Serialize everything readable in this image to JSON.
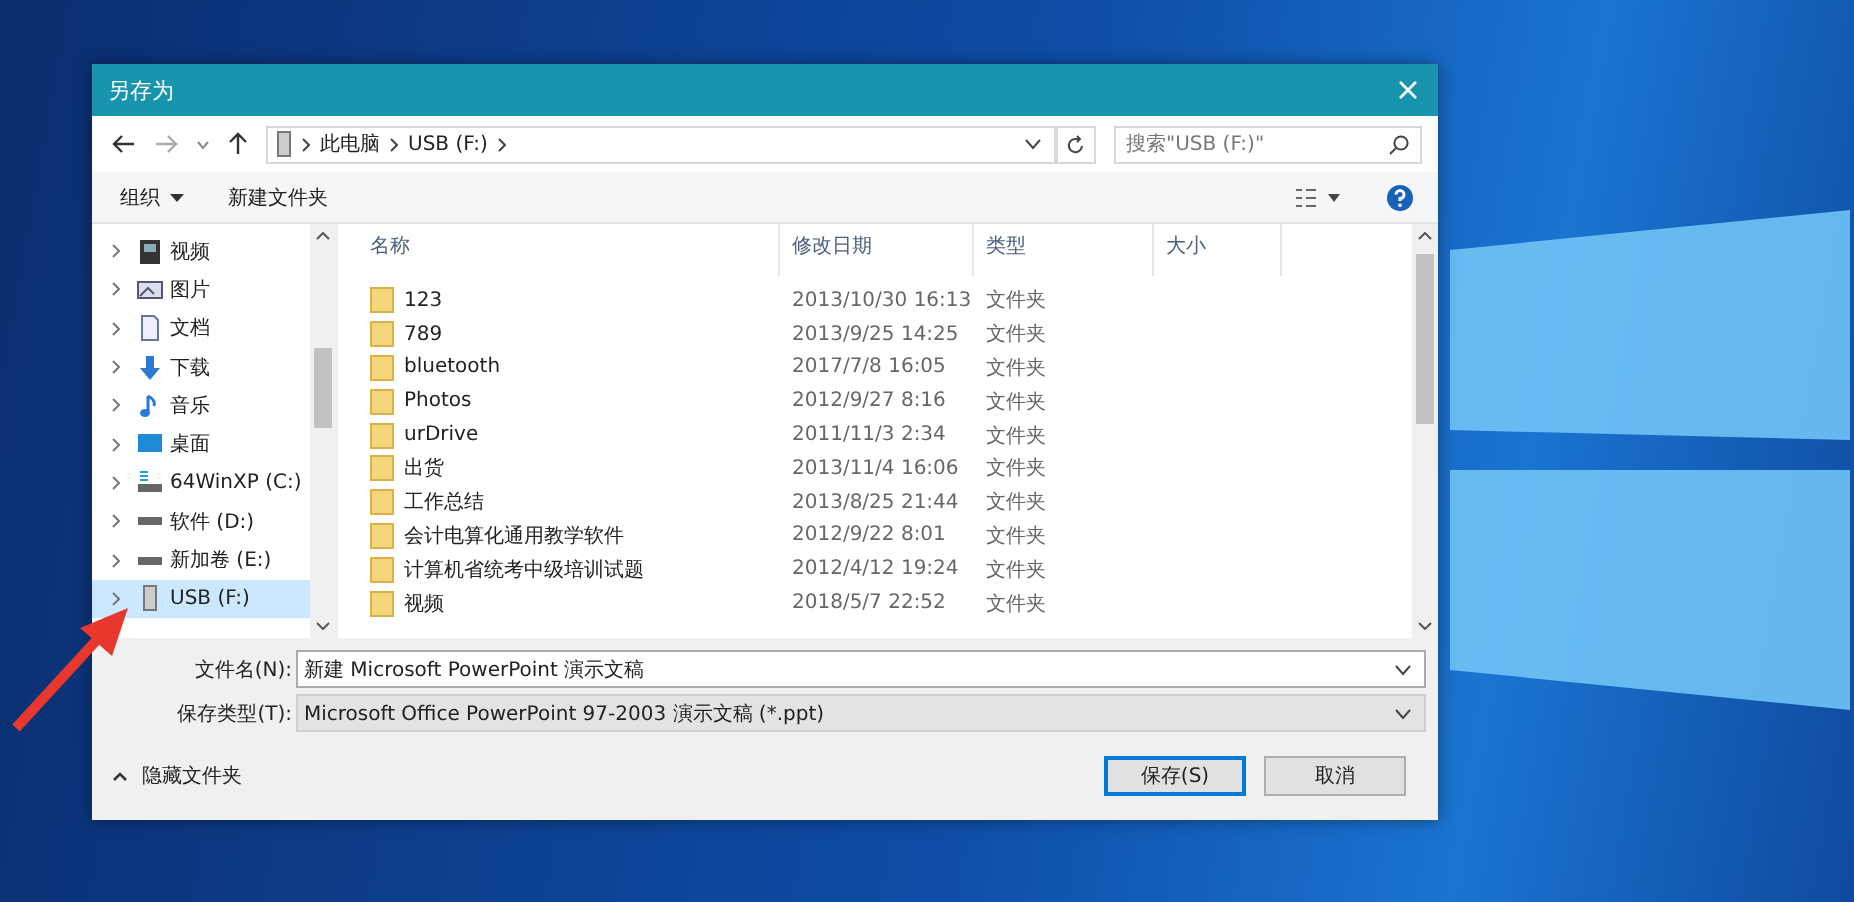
{
  "window": {
    "title": "另存为"
  },
  "address": {
    "crumbs": [
      "此电脑",
      "USB (F:)"
    ],
    "search_placeholder": "搜索\"USB (F:)\""
  },
  "toolbar": {
    "organize": "组织",
    "new_folder": "新建文件夹"
  },
  "sidebar": {
    "items": [
      {
        "label": "视频",
        "kind": "video",
        "selected": false
      },
      {
        "label": "图片",
        "kind": "picture",
        "selected": false
      },
      {
        "label": "文档",
        "kind": "document",
        "selected": false
      },
      {
        "label": "下载",
        "kind": "download",
        "selected": false
      },
      {
        "label": "音乐",
        "kind": "music",
        "selected": false
      },
      {
        "label": "桌面",
        "kind": "desktop",
        "selected": false
      },
      {
        "label": "64WinXP  (C:)",
        "kind": "system-drive",
        "selected": false
      },
      {
        "label": "软件 (D:)",
        "kind": "drive",
        "selected": false
      },
      {
        "label": "新加卷 (E:)",
        "kind": "drive",
        "selected": false
      },
      {
        "label": "USB (F:)",
        "kind": "usb",
        "selected": true
      }
    ]
  },
  "table": {
    "columns": [
      "名称",
      "修改日期",
      "类型",
      "大小"
    ],
    "rows": [
      {
        "name": "123",
        "date": "2013/10/30 16:13",
        "type": "文件夹"
      },
      {
        "name": "789",
        "date": "2013/9/25 14:25",
        "type": "文件夹"
      },
      {
        "name": "bluetooth",
        "date": "2017/7/8 16:05",
        "type": "文件夹"
      },
      {
        "name": "Photos",
        "date": "2012/9/27 8:16",
        "type": "文件夹"
      },
      {
        "name": "urDrive",
        "date": "2011/11/3 2:34",
        "type": "文件夹"
      },
      {
        "name": "出货",
        "date": "2013/11/4 16:06",
        "type": "文件夹"
      },
      {
        "name": "工作总结",
        "date": "2013/8/25 21:44",
        "type": "文件夹"
      },
      {
        "name": "会计电算化通用教学软件",
        "date": "2012/9/22 8:01",
        "type": "文件夹"
      },
      {
        "name": "计算机省统考中级培训试题",
        "date": "2012/4/12 19:24",
        "type": "文件夹"
      },
      {
        "name": "视频",
        "date": "2018/5/7 22:52",
        "type": "文件夹"
      }
    ]
  },
  "fields": [
    {
      "label": "文件名(N):",
      "value": "新建 Microsoft PowerPoint 演示文稿",
      "disabled": false
    },
    {
      "label": "保存类型(T):",
      "value": "Microsoft Office PowerPoint 97-2003 演示文稿 (*.ppt)",
      "disabled": true
    }
  ],
  "hide_folders": "隐藏文件夹",
  "buttons": [
    {
      "label": "保存(S)",
      "selected": true
    },
    {
      "label": "取消",
      "selected": false
    }
  ]
}
